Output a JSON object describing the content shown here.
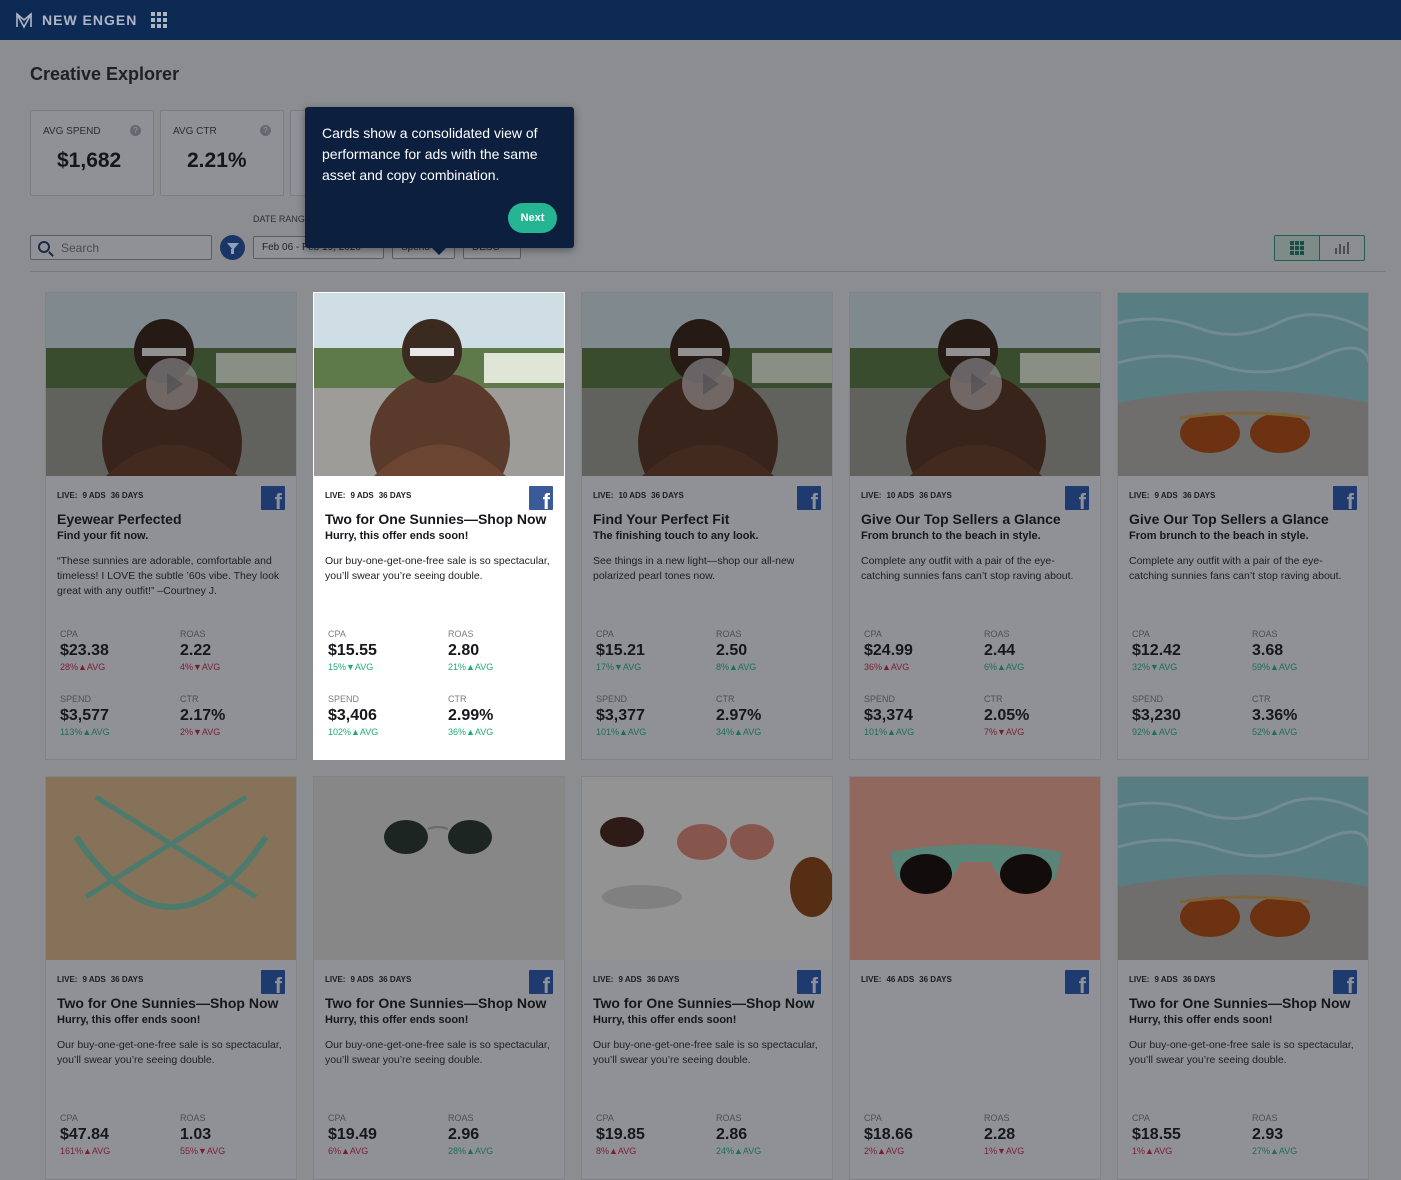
{
  "header": {
    "brand": "NEW ENGEN"
  },
  "page": {
    "title": "Creative Explorer"
  },
  "kpis": [
    {
      "label": "AVG SPEND",
      "value": "$1,682"
    },
    {
      "label": "AVG CTR",
      "value": "2.21%"
    }
  ],
  "toolbar": {
    "date_range_label": "DATE RANG",
    "search_placeholder": "Search",
    "date_range_value": "Feb 06 - Feb 19, 2020",
    "sort_field": "Spend",
    "sort_order": "DESC"
  },
  "tooltip": {
    "text": "Cards show a consolidated view of performance for ads with the same asset and copy combination.",
    "next_label": "Next"
  },
  "cards": [
    {
      "live": "LIVE:",
      "ads": "9 ADS",
      "days": "36 DAYS",
      "headline": "Eyewear Perfected",
      "sub": "Find your fit now.",
      "body": "“These sunnies are adorable, comfortable and timeless! I LOVE the subtle ’60s vibe. They look great with any outfit!” –Courtney J.",
      "metrics": [
        {
          "label": "CPA",
          "value": "$23.38",
          "delta": "28%▲AVG",
          "dir": "down"
        },
        {
          "label": "ROAS",
          "value": "2.22",
          "delta": "4%▼AVG",
          "dir": "down"
        },
        {
          "label": "SPEND",
          "value": "$3,577",
          "delta": "113%▲AVG",
          "dir": "up"
        },
        {
          "label": "CTR",
          "value": "2.17%",
          "delta": "2%▼AVG",
          "dir": "down"
        }
      ]
    },
    {
      "live": "LIVE:",
      "ads": "9 ADS",
      "days": "36 DAYS",
      "headline": "Two for One Sunnies—Shop Now",
      "sub": "Hurry, this offer ends soon!",
      "body": "Our buy-one-get-one-free sale is so spectacular, you’ll swear you’re seeing double.",
      "metrics": [
        {
          "label": "CPA",
          "value": "$15.55",
          "delta": "15%▼AVG",
          "dir": "up"
        },
        {
          "label": "ROAS",
          "value": "2.80",
          "delta": "21%▲AVG",
          "dir": "up"
        },
        {
          "label": "SPEND",
          "value": "$3,406",
          "delta": "102%▲AVG",
          "dir": "up"
        },
        {
          "label": "CTR",
          "value": "2.99%",
          "delta": "36%▲AVG",
          "dir": "up"
        }
      ]
    },
    {
      "live": "LIVE:",
      "ads": "10 ADS",
      "days": "36 DAYS",
      "headline": "Find Your Perfect Fit",
      "sub": "The finishing touch to any look.",
      "body": "See things in a new light—shop our all-new polarized pearl tones now.",
      "metrics": [
        {
          "label": "CPA",
          "value": "$15.21",
          "delta": "17%▼AVG",
          "dir": "up"
        },
        {
          "label": "ROAS",
          "value": "2.50",
          "delta": "8%▲AVG",
          "dir": "up"
        },
        {
          "label": "SPEND",
          "value": "$3,377",
          "delta": "101%▲AVG",
          "dir": "up"
        },
        {
          "label": "CTR",
          "value": "2.97%",
          "delta": "34%▲AVG",
          "dir": "up"
        }
      ]
    },
    {
      "live": "LIVE:",
      "ads": "10 ADS",
      "days": "36 DAYS",
      "headline": "Give Our Top Sellers a Glance",
      "sub": "From brunch to the beach in style.",
      "body": "Complete any outfit with a pair of the eye-catching sunnies fans can’t stop raving about.",
      "metrics": [
        {
          "label": "CPA",
          "value": "$24.99",
          "delta": "36%▲AVG",
          "dir": "down"
        },
        {
          "label": "ROAS",
          "value": "2.44",
          "delta": "6%▲AVG",
          "dir": "up"
        },
        {
          "label": "SPEND",
          "value": "$3,374",
          "delta": "101%▲AVG",
          "dir": "up"
        },
        {
          "label": "CTR",
          "value": "2.05%",
          "delta": "7%▼AVG",
          "dir": "down"
        }
      ]
    },
    {
      "live": "LIVE:",
      "ads": "9 ADS",
      "days": "36 DAYS",
      "headline": "Give Our Top Sellers a Glance",
      "sub": "From brunch to the beach in style.",
      "body": "Complete any outfit with a pair of the eye-catching sunnies fans can’t stop raving about.",
      "metrics": [
        {
          "label": "CPA",
          "value": "$12.42",
          "delta": "32%▼AVG",
          "dir": "up"
        },
        {
          "label": "ROAS",
          "value": "3.68",
          "delta": "59%▲AVG",
          "dir": "up"
        },
        {
          "label": "SPEND",
          "value": "$3,230",
          "delta": "92%▲AVG",
          "dir": "up"
        },
        {
          "label": "CTR",
          "value": "3.36%",
          "delta": "52%▲AVG",
          "dir": "up"
        }
      ]
    },
    {
      "live": "LIVE:",
      "ads": "9 ADS",
      "days": "36 DAYS",
      "headline": "Two for One Sunnies—Shop Now",
      "sub": "Hurry, this offer ends soon!",
      "body": "Our buy-one-get-one-free sale is so spectacular, you’ll swear you’re seeing double.",
      "metrics": [
        {
          "label": "CPA",
          "value": "$47.84",
          "delta": "161%▲AVG",
          "dir": "down"
        },
        {
          "label": "ROAS",
          "value": "1.03",
          "delta": "55%▼AVG",
          "dir": "down"
        }
      ]
    },
    {
      "live": "LIVE:",
      "ads": "9 ADS",
      "days": "36 DAYS",
      "headline": "Two for One Sunnies—Shop Now",
      "sub": "Hurry, this offer ends soon!",
      "body": "Our buy-one-get-one-free sale is so spectacular, you’ll swear you’re seeing double.",
      "metrics": [
        {
          "label": "CPA",
          "value": "$19.49",
          "delta": "6%▲AVG",
          "dir": "down"
        },
        {
          "label": "ROAS",
          "value": "2.96",
          "delta": "28%▲AVG",
          "dir": "up"
        }
      ]
    },
    {
      "live": "LIVE:",
      "ads": "9 ADS",
      "days": "36 DAYS",
      "headline": "Two for One Sunnies—Shop Now",
      "sub": "Hurry, this offer ends soon!",
      "body": "Our buy-one-get-one-free sale is so spectacular, you’ll swear you’re seeing double.",
      "metrics": [
        {
          "label": "CPA",
          "value": "$19.85",
          "delta": "8%▲AVG",
          "dir": "down"
        },
        {
          "label": "ROAS",
          "value": "2.86",
          "delta": "24%▲AVG",
          "dir": "up"
        }
      ]
    },
    {
      "live": "LIVE:",
      "ads": "46 ADS",
      "days": "36 DAYS",
      "headline": "",
      "sub": "",
      "body": "",
      "metrics": [
        {
          "label": "CPA",
          "value": "$18.66",
          "delta": "2%▲AVG",
          "dir": "down"
        },
        {
          "label": "ROAS",
          "value": "2.28",
          "delta": "1%▼AVG",
          "dir": "down"
        }
      ]
    },
    {
      "live": "LIVE:",
      "ads": "9 ADS",
      "days": "36 DAYS",
      "headline": "Two for One Sunnies—Shop Now",
      "sub": "Hurry, this offer ends soon!",
      "body": "Our buy-one-get-one-free sale is so spectacular, you’ll swear you’re seeing double.",
      "metrics": [
        {
          "label": "CPA",
          "value": "$18.55",
          "delta": "1%▲AVG",
          "dir": "down"
        },
        {
          "label": "ROAS",
          "value": "2.93",
          "delta": "27%▲AVG",
          "dir": "up"
        }
      ]
    }
  ]
}
